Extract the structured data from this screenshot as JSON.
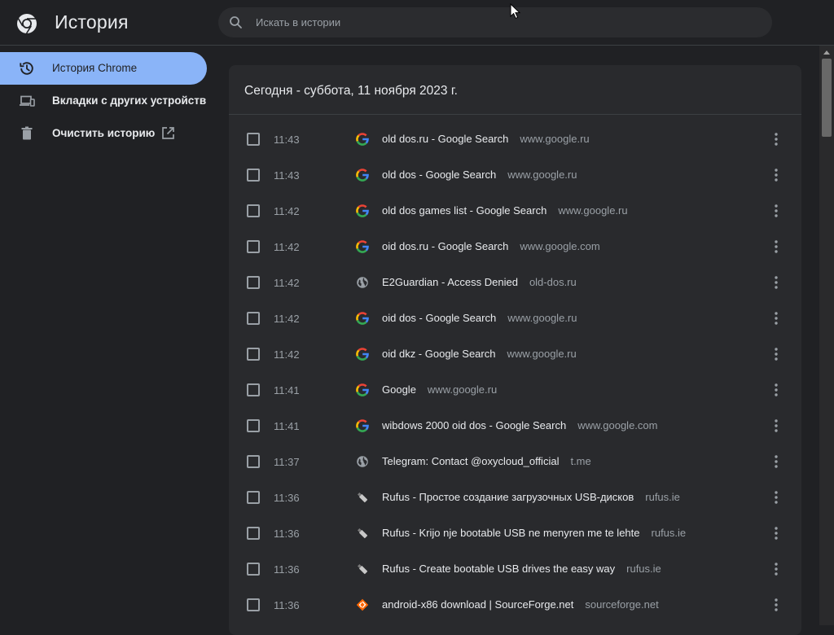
{
  "header": {
    "title": "История",
    "search": {
      "placeholder": "Искать в истории",
      "value": ""
    }
  },
  "sidebar": {
    "items": [
      {
        "label": "История Chrome",
        "icon": "history-icon",
        "active": true
      },
      {
        "label": "Вкладки с других устройств",
        "icon": "devices-icon",
        "active": false
      },
      {
        "label": "Очистить историю",
        "icon": "trash-icon",
        "active": false,
        "trailing_icon": "open-in-new-icon"
      }
    ]
  },
  "main": {
    "date_heading": "Сегодня - суббота, 11 ноября 2023 г.",
    "entries": [
      {
        "time": "11:43",
        "title": "old dos.ru - Google Search",
        "domain": "www.google.ru",
        "favicon": "google-icon"
      },
      {
        "time": "11:43",
        "title": "old dos - Google Search",
        "domain": "www.google.ru",
        "favicon": "google-icon"
      },
      {
        "time": "11:42",
        "title": "old dos games list - Google Search",
        "domain": "www.google.ru",
        "favicon": "google-icon"
      },
      {
        "time": "11:42",
        "title": "oid dos.ru - Google Search",
        "domain": "www.google.com",
        "favicon": "google-icon"
      },
      {
        "time": "11:42",
        "title": "E2Guardian - Access Denied",
        "domain": "old-dos.ru",
        "favicon": "globe-icon"
      },
      {
        "time": "11:42",
        "title": "oid dos - Google Search",
        "domain": "www.google.ru",
        "favicon": "google-icon"
      },
      {
        "time": "11:42",
        "title": "oid dkz - Google Search",
        "domain": "www.google.ru",
        "favicon": "google-icon"
      },
      {
        "time": "11:41",
        "title": "Google",
        "domain": "www.google.ru",
        "favicon": "google-icon"
      },
      {
        "time": "11:41",
        "title": "wibdows 2000 oid dos - Google Search",
        "domain": "www.google.com",
        "favicon": "google-icon"
      },
      {
        "time": "11:37",
        "title": "Telegram: Contact @oxycloud_official",
        "domain": "t.me",
        "favicon": "globe-icon"
      },
      {
        "time": "11:36",
        "title": "Rufus - Простое создание загрузочных USB-дисков",
        "domain": "rufus.ie",
        "favicon": "usb-drive-icon"
      },
      {
        "time": "11:36",
        "title": "Rufus - Krijo nje bootable USB ne menyren me te lehte",
        "domain": "rufus.ie",
        "favicon": "usb-drive-icon"
      },
      {
        "time": "11:36",
        "title": "Rufus - Create bootable USB drives the easy way",
        "domain": "rufus.ie",
        "favicon": "usb-drive-icon"
      },
      {
        "time": "11:36",
        "title": "android-x86 download | SourceForge.net",
        "domain": "sourceforge.net",
        "favicon": "sourceforge-icon"
      }
    ]
  },
  "colors": {
    "background": "#202124",
    "card": "#292a2d",
    "accent": "#8ab4f8",
    "text_primary": "#e8eaed",
    "text_secondary": "#9aa0a6"
  }
}
